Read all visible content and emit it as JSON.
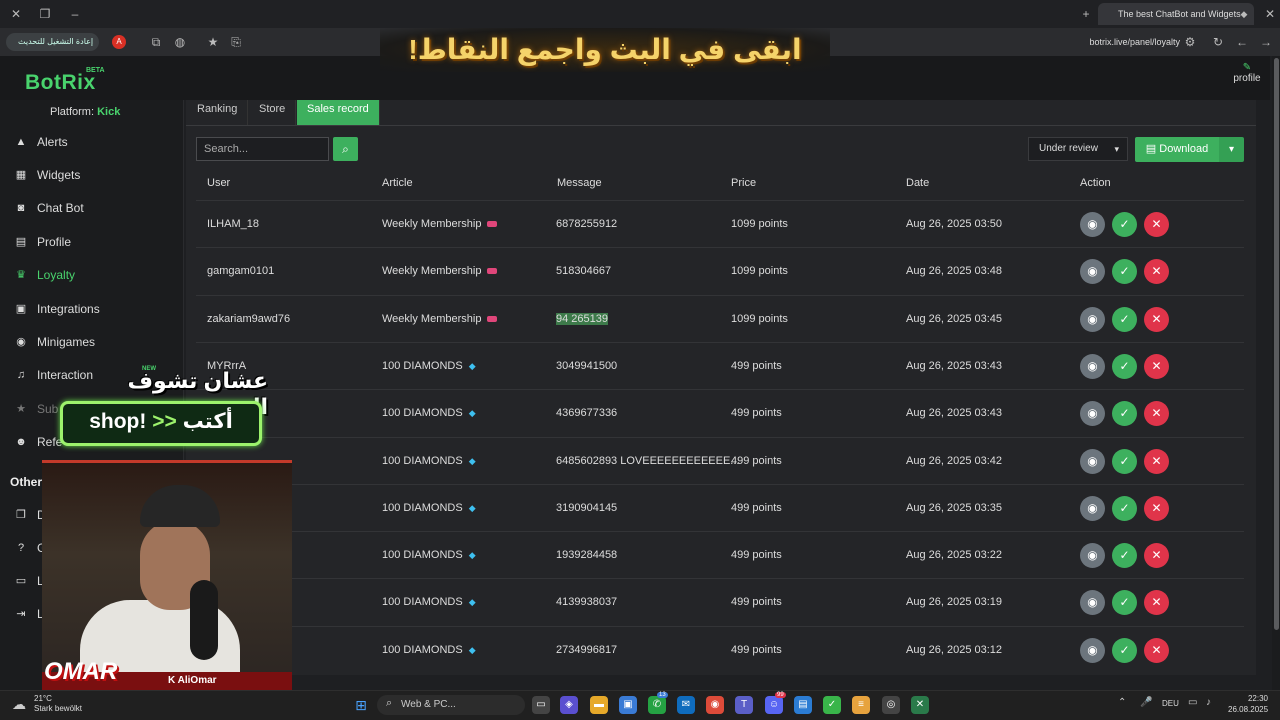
{
  "browser": {
    "tab_title": "The best ChatBot and Widgets",
    "reload_label": "إعادة التشغيل للتحديث",
    "url": "botrix.live/panel/loyalty"
  },
  "stream_banner": "ابقى في البث واجمع النقاط!",
  "app": {
    "logo": "BotRix",
    "beta": "BETA",
    "profile_label": "profile",
    "platform_label": "Platform:",
    "platform_value": "Kick"
  },
  "sidebar": {
    "items": [
      {
        "label": "Alerts",
        "icon": "warning-icon"
      },
      {
        "label": "Widgets",
        "icon": "grid-icon"
      },
      {
        "label": "Chat Bot",
        "icon": "robot-icon"
      },
      {
        "label": "Profile",
        "icon": "id-card-icon"
      },
      {
        "label": "Loyalty",
        "icon": "trophy-icon",
        "active": true
      },
      {
        "label": "Integrations",
        "icon": "plug-icon"
      },
      {
        "label": "Minigames",
        "icon": "gamepad-icon"
      },
      {
        "label": "Interaction",
        "icon": "music-icon"
      },
      {
        "label": "Sub",
        "icon": "star-icon"
      },
      {
        "label": "Refe",
        "icon": "users-icon"
      }
    ],
    "new_badge": "NEW",
    "other_heading": "Other",
    "other_items": [
      "D",
      "G",
      "L",
      "L"
    ]
  },
  "tabs": [
    {
      "label": "Ranking"
    },
    {
      "label": "Store"
    },
    {
      "label": "Sales record",
      "selected": true
    }
  ],
  "toolbar": {
    "search_placeholder": "Search...",
    "status_filter": "Under review",
    "download_label": "Download"
  },
  "table": {
    "headers": [
      "User",
      "Article",
      "Message",
      "Price",
      "Date",
      "Action"
    ],
    "rows": [
      {
        "user": "ILHAM_18",
        "article": "Weekly Membership",
        "kind": "membership",
        "message": "6878255912",
        "price": "1099 points",
        "date": "Aug 26, 2025 03:50"
      },
      {
        "user": "gamgam0101",
        "article": "Weekly Membership",
        "kind": "membership",
        "message": "518304667",
        "price": "1099 points",
        "date": "Aug 26, 2025 03:48"
      },
      {
        "user": "zakariam9awd76",
        "article": "Weekly Membership",
        "kind": "membership",
        "message": "94 265139",
        "price": "1099 points",
        "date": "Aug 26, 2025 03:45",
        "highlight": true
      },
      {
        "user": "MYRrrA",
        "article": "100 DIAMONDS",
        "kind": "diamond",
        "message": "3049941500",
        "price": "499 points",
        "date": "Aug 26, 2025 03:43"
      },
      {
        "user": "",
        "article": "100 DIAMONDS",
        "kind": "diamond",
        "message": "4369677336",
        "price": "499 points",
        "date": "Aug 26, 2025 03:43"
      },
      {
        "user": "",
        "article": "100 DIAMONDS",
        "kind": "diamond",
        "message": "6485602893 LOVEEEEEEEEEEEE...",
        "price": "499 points",
        "date": "Aug 26, 2025 03:42"
      },
      {
        "user": "",
        "article": "100 DIAMONDS",
        "kind": "diamond",
        "message": "3190904145",
        "price": "499 points",
        "date": "Aug 26, 2025 03:35"
      },
      {
        "user": "",
        "article": "100 DIAMONDS",
        "kind": "diamond",
        "message": "1939284458",
        "price": "499 points",
        "date": "Aug 26, 2025 03:22"
      },
      {
        "user": "",
        "article": "100 DIAMONDS",
        "kind": "diamond",
        "message": "4139938037",
        "price": "499 points",
        "date": "Aug 26, 2025 03:19"
      },
      {
        "user": "",
        "article": "100 DIAMONDS",
        "kind": "diamond",
        "message": "2734996817",
        "price": "499 points",
        "date": "Aug 26, 2025 03:12"
      }
    ]
  },
  "overlay": {
    "line1": "عشان تشوف المتجر:",
    "write": "أكتب",
    "command": "!shop",
    "arrows": "<<",
    "streamer_logo": "OMAR",
    "streamer_name": "AliOmar",
    "kick_k": "K"
  },
  "taskbar": {
    "temp": "21°C",
    "weather": "Stark bewölkt",
    "search": "Web & PC...",
    "lang": "DEU",
    "time": "22:30",
    "date": "26.08.2025",
    "badge_1": "13",
    "badge_2": "99"
  },
  "colors": {
    "accent": "#3db05e",
    "danger": "#e0344a",
    "neutral": "#6c757d",
    "background": "#242528"
  }
}
